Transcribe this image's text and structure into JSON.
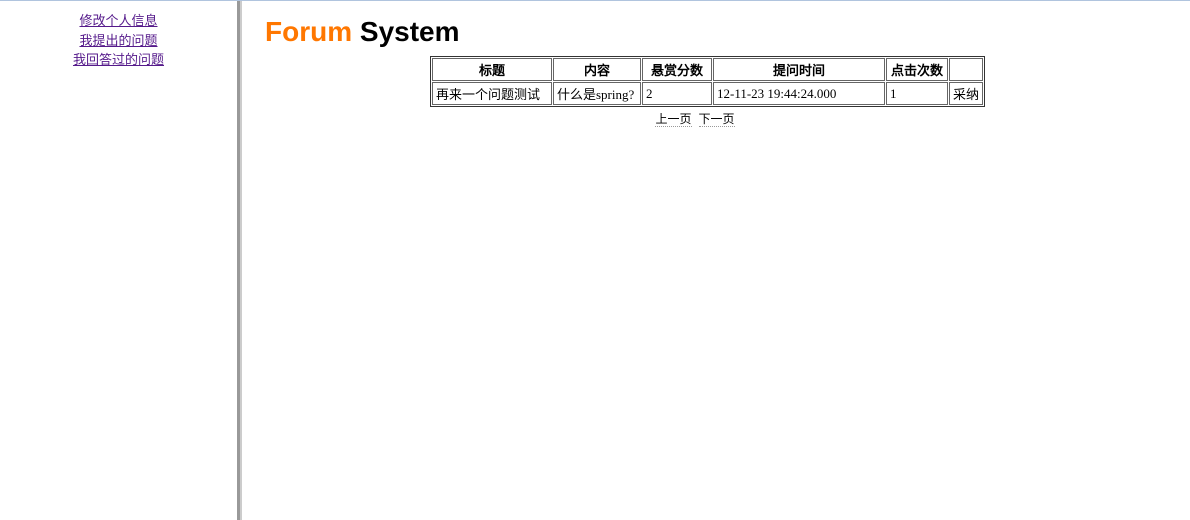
{
  "sidebar": {
    "links": [
      {
        "label": "修改个人信息"
      },
      {
        "label": "我提出的问题"
      },
      {
        "label": "我回答过的问题"
      }
    ]
  },
  "header": {
    "title_part1": "Forum",
    "title_part2": " System"
  },
  "table": {
    "headers": {
      "title": "标题",
      "content": "内容",
      "bounty": "悬赏分数",
      "time": "提问时间",
      "clicks": "点击次数"
    },
    "rows": [
      {
        "title": "再来一个问题测试",
        "content": "什么是spring?",
        "bounty": "2",
        "time": "12-11-23 19:44:24.000",
        "clicks": "1",
        "action": "采纳"
      }
    ]
  },
  "pagination": {
    "prev": "上一页",
    "next": "下一页"
  }
}
